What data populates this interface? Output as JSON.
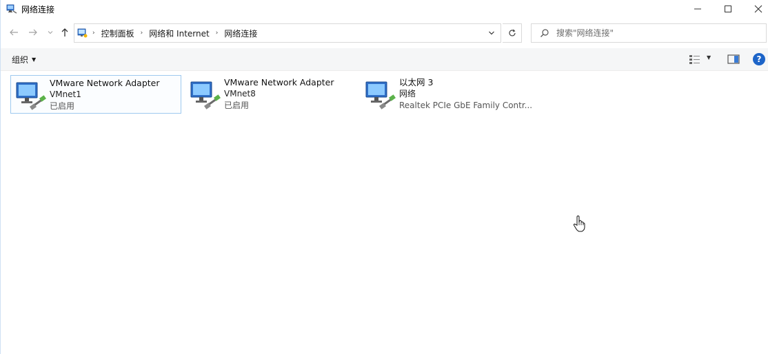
{
  "window": {
    "title": "网络连接",
    "controls": {
      "minimize": "—",
      "maximize": "☐",
      "close": "✕"
    }
  },
  "nav": {
    "back_icon": "arrow-left-icon",
    "forward_icon": "arrow-right-icon",
    "recent_icon": "chevron-down-icon",
    "up_icon": "arrow-up-icon"
  },
  "address": {
    "breadcrumbs": [
      "控制面板",
      "网络和 Internet",
      "网络连接"
    ],
    "separator": "›"
  },
  "search": {
    "placeholder": "搜索\"网络连接\""
  },
  "toolbar": {
    "organize_label": "组织",
    "organize_caret": "▼",
    "view_caret": "▼",
    "help_label": "?"
  },
  "connections": [
    {
      "name": "VMware Network Adapter",
      "subname": "VMnet1",
      "status": "已启用",
      "selected": true
    },
    {
      "name": "VMware Network Adapter",
      "subname": "VMnet8",
      "status": "已启用",
      "selected": false
    },
    {
      "name": "以太网 3",
      "subname": "网络",
      "status": "Realtek PCIe GbE Family Contr...",
      "selected": false
    }
  ],
  "colors": {
    "selection_border": "#9ec9ef",
    "command_bar_bg": "#f5f6f7",
    "help_blue": "#1c64c8"
  }
}
